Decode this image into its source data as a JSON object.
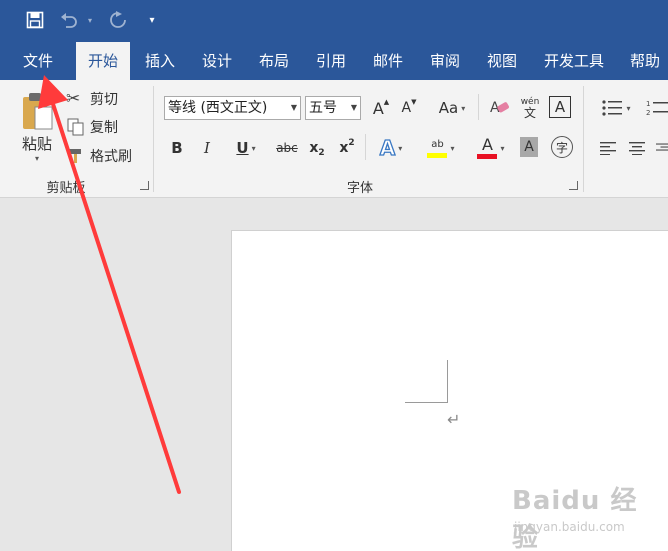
{
  "tabs": [
    "文件",
    "开始",
    "插入",
    "设计",
    "布局",
    "引用",
    "邮件",
    "审阅",
    "视图",
    "开发工具",
    "帮助"
  ],
  "clipboard": {
    "paste_label": "粘贴",
    "cut_label": "剪切",
    "copy_label": "复制",
    "format_painter_label": "格式刷",
    "group_label": "剪贴板"
  },
  "font": {
    "font_name": "等线 (西文正文)",
    "font_size": "五号",
    "group_label": "字体",
    "bold": "B",
    "italic": "I",
    "underline": "U",
    "strikethrough": "abc",
    "subscript_base": "x",
    "subscript_sub": "2",
    "superscript_base": "x",
    "superscript_sup": "2",
    "change_case": "Aa",
    "grow": "A",
    "shrink": "A",
    "phonetic_top": "wén",
    "phonetic_bottom": "文",
    "char_border": "A",
    "text_effects": "A",
    "highlight_top": "ab",
    "font_color": "A",
    "char_shading": "A",
    "enclose_char": "字"
  },
  "watermark": {
    "logo_text": "Baidu 经验",
    "sub_text": "jingyan.baidu.com"
  },
  "colors": {
    "title_bar": "#2b579a",
    "ribbon_bg": "#f3f3f3",
    "highlight_yellow": "#ffff00",
    "font_color_red": "#e81123",
    "annotation_arrow": "#ff3b3b"
  }
}
